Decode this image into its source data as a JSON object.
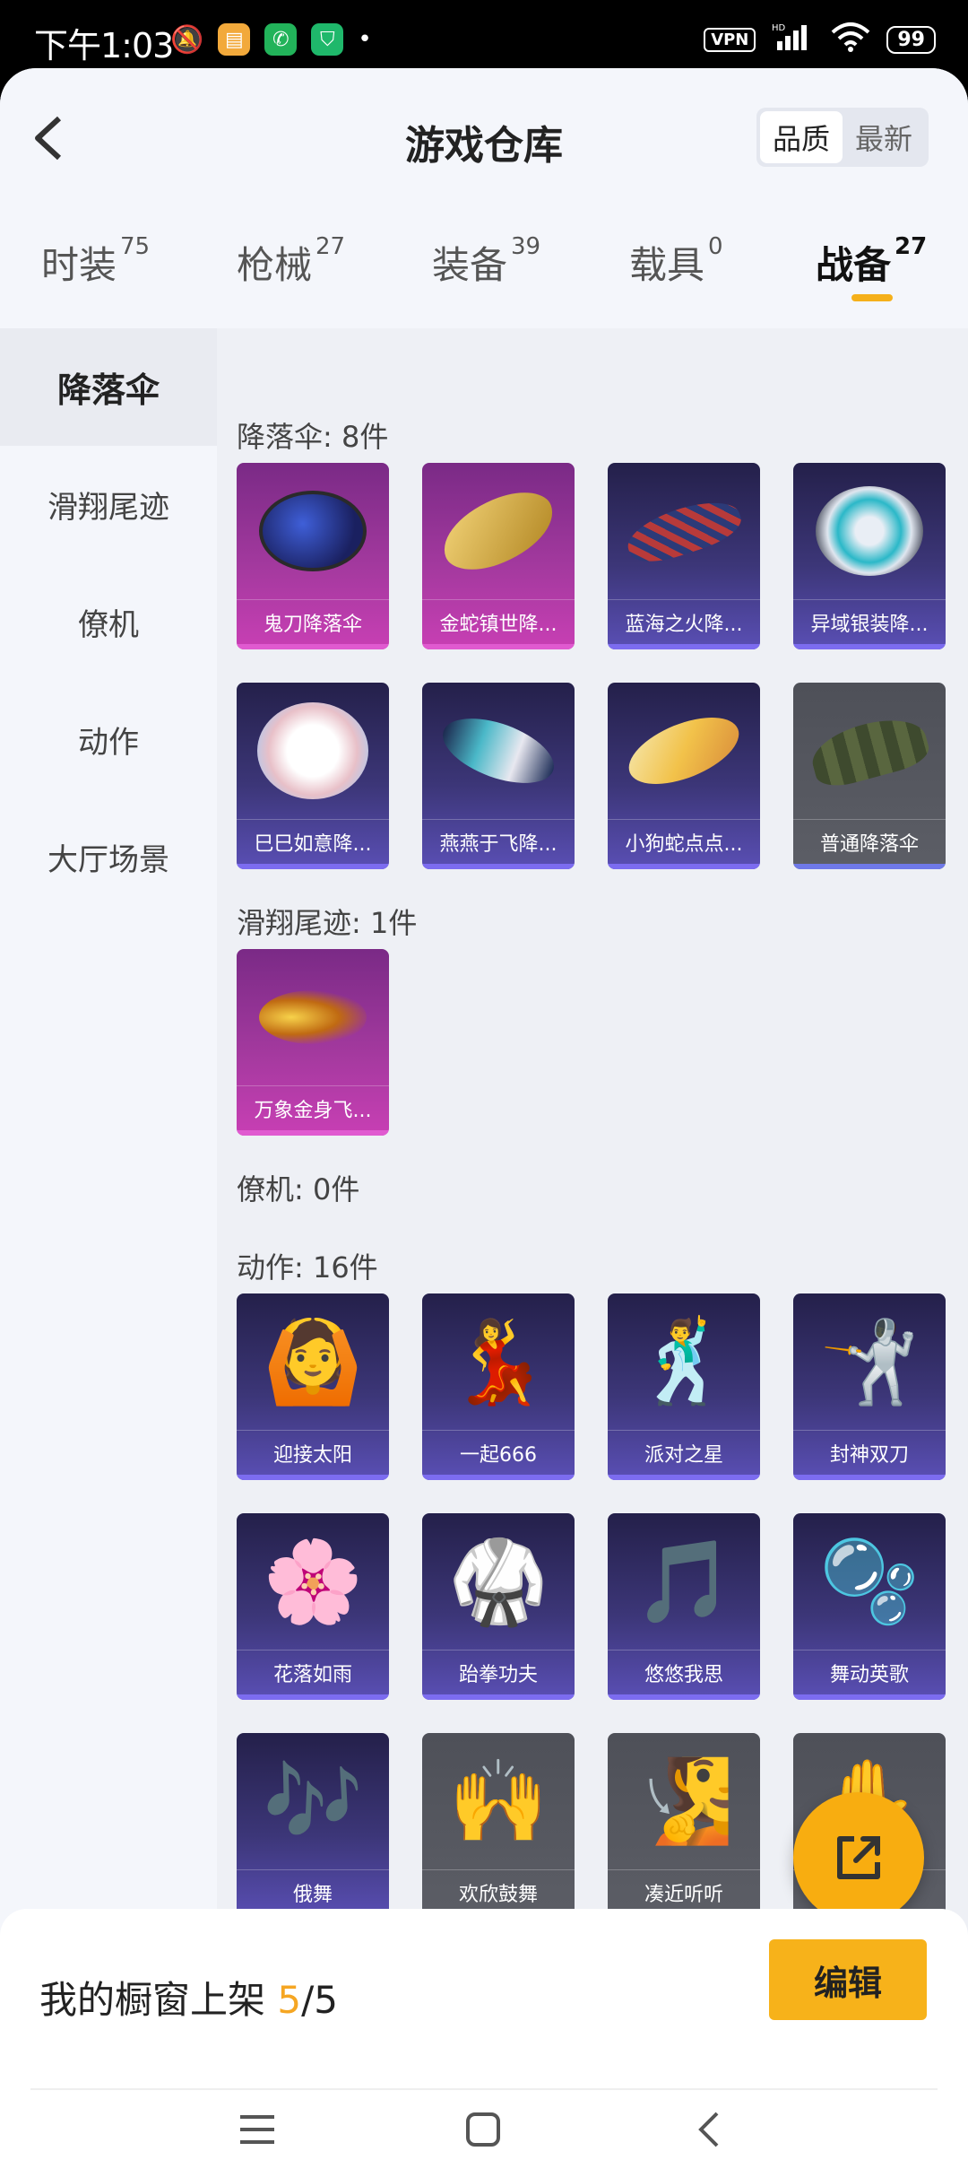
{
  "status": {
    "time": "下午1:03",
    "vpn": "VPN",
    "hd": "HD",
    "battery": "99"
  },
  "header": {
    "title": "游戏仓库",
    "sort_quality": "品质",
    "sort_latest": "最新"
  },
  "tabs": [
    {
      "label": "时装",
      "count": "75"
    },
    {
      "label": "枪械",
      "count": "27"
    },
    {
      "label": "装备",
      "count": "39"
    },
    {
      "label": "载具",
      "count": "0"
    },
    {
      "label": "战备",
      "count": "27"
    }
  ],
  "sidebar": [
    "降落伞",
    "滑翔尾迹",
    "僚机",
    "动作",
    "大厅场景"
  ],
  "sections": {
    "parachute": "降落伞: 8件",
    "trail": "滑翔尾迹: 1件",
    "wingman": "僚机: 0件",
    "action": "动作: 16件"
  },
  "parachutes": [
    "鬼刀降落伞",
    "金蛇镇世降...",
    "蓝海之火降...",
    "异域银装降...",
    "巳巳如意降...",
    "燕燕于飞降...",
    "小狗蛇点点...",
    "普通降落伞"
  ],
  "trails": [
    "万象金身飞..."
  ],
  "actions": [
    "迎接太阳",
    "一起666",
    "派对之星",
    "封神双刀",
    "花落如雨",
    "跆拳功夫",
    "悠悠我思",
    "舞动英歌",
    "俄舞",
    "欢欣鼓舞",
    "凑近听听",
    ""
  ],
  "footer": {
    "showcase_label": "我的橱窗上架",
    "count": "5",
    "total": "/5",
    "edit": "编辑"
  },
  "colors": {
    "accent": "#f7b21a",
    "rare": "#c83fb4",
    "epic": "#5a4fb5",
    "common": "#5c5e66"
  }
}
